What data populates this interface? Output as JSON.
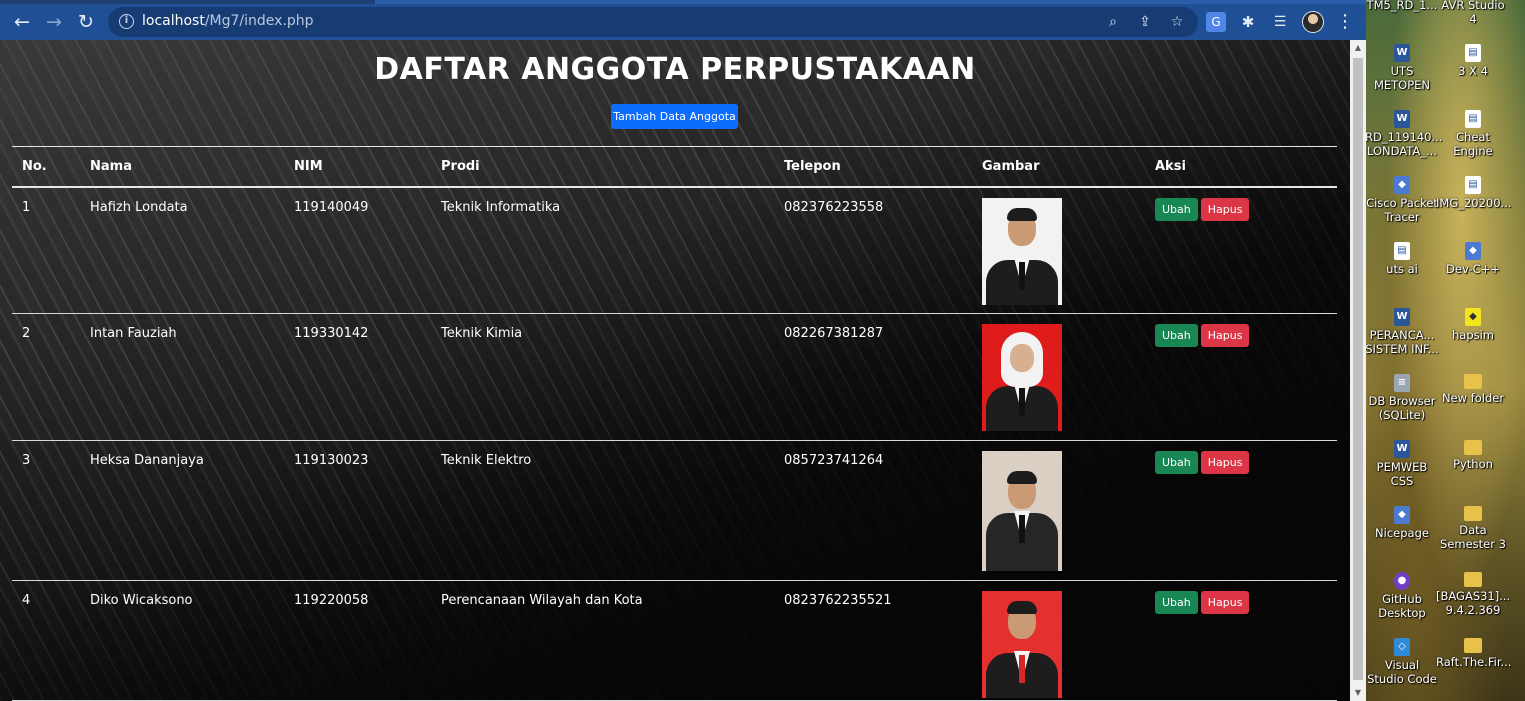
{
  "browser": {
    "url_host": "localhost",
    "url_path": "/Mg7/index.php",
    "nav": {
      "back": "←",
      "forward": "→",
      "reload": "↻"
    }
  },
  "page": {
    "title": "DAFTAR ANGGOTA PERPUSTAKAAN",
    "add_button": "Tambah Data Anggota",
    "columns": [
      "No.",
      "Nama",
      "NIM",
      "Prodi",
      "Telepon",
      "Gambar",
      "Aksi"
    ],
    "rows": [
      {
        "no": "1",
        "nama": "Hafizh Londata",
        "nim": "119140049",
        "prodi": "Teknik Informatika",
        "telepon": "082376223558",
        "photo_bg": "#f2f2f2"
      },
      {
        "no": "2",
        "nama": "Intan Fauziah",
        "nim": "119330142",
        "prodi": "Teknik Kimia",
        "telepon": "082267381287",
        "photo_bg": "#e01b1b"
      },
      {
        "no": "3",
        "nama": "Heksa Dananjaya",
        "nim": "119130023",
        "prodi": "Teknik Elektro",
        "telepon": "085723741264",
        "photo_bg": "#d9cfc2"
      },
      {
        "no": "4",
        "nama": "Diko Wicaksono",
        "nim": "119220058",
        "prodi": "Perencanaan Wilayah dan Kota",
        "telepon": "0823762235521",
        "photo_bg": "#e53030"
      }
    ],
    "edit_label": "Ubah",
    "delete_label": "Hapus"
  },
  "desktop": {
    "icons": [
      {
        "label": "TM5_RD_1...",
        "icon": "file-icon"
      },
      {
        "label": "AVR Studio 4",
        "icon": "app-icon"
      },
      {
        "label": "UTS METOPEN",
        "icon": "word-icon"
      },
      {
        "label": "3 X 4",
        "icon": "file-icon"
      },
      {
        "label": "RD_119140... LONDATA_...",
        "icon": "word-icon"
      },
      {
        "label": "Cheat Engine",
        "icon": "file-icon"
      },
      {
        "label": "Cisco Packet Tracer",
        "icon": "app-icon"
      },
      {
        "label": "IMG_20200...",
        "icon": "file-icon"
      },
      {
        "label": "uts ai",
        "icon": "file-icon"
      },
      {
        "label": "Dev-C++",
        "icon": "app-icon"
      },
      {
        "label": "PERANCA... SISTEM INF...",
        "icon": "word-icon"
      },
      {
        "label": "hapsim",
        "icon": "app-icon"
      },
      {
        "label": "DB Browser (SQLite)",
        "icon": "db-icon"
      },
      {
        "label": "New folder",
        "icon": "folder-icon"
      },
      {
        "label": "PEMWEB CSS",
        "icon": "word-icon"
      },
      {
        "label": "Python",
        "icon": "folder-icon"
      },
      {
        "label": "Nicepage",
        "icon": "app-icon"
      },
      {
        "label": "Data Semester 3",
        "icon": "folder-icon"
      },
      {
        "label": "GitHub Desktop",
        "icon": "github-icon"
      },
      {
        "label": "[BAGAS31]... 9.4.2.369",
        "icon": "folder-icon"
      },
      {
        "label": "Visual Studio Code",
        "icon": "vscode-icon"
      },
      {
        "label": "Raft.The.Fir...",
        "icon": "folder-icon"
      }
    ]
  }
}
